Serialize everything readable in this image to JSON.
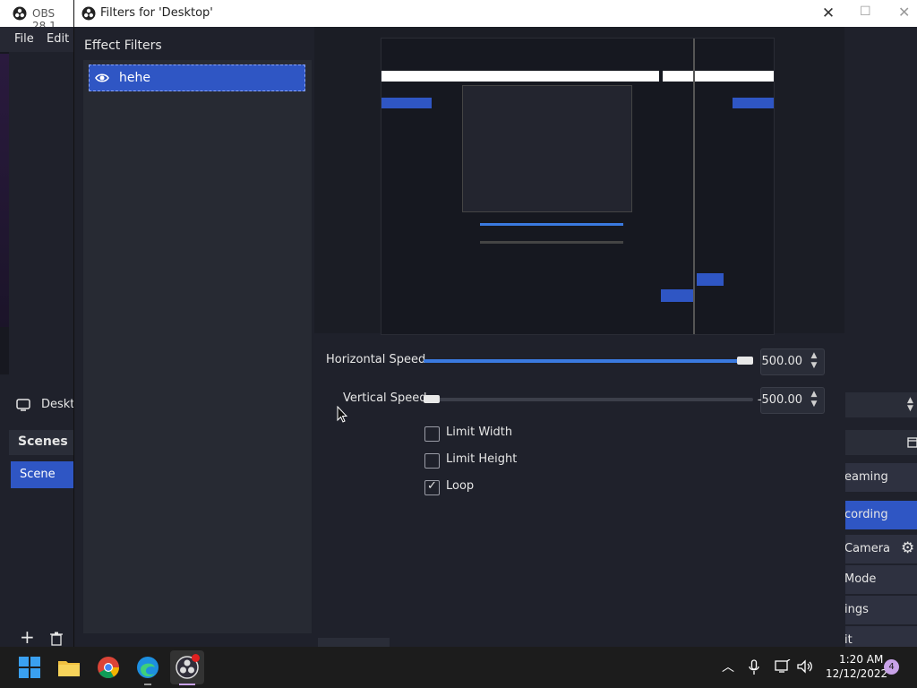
{
  "main_window": {
    "title": "OBS 28.1",
    "menu": {
      "file": "File",
      "edit": "Edit"
    },
    "source_name": "Deskto",
    "scenes_header": "Scenes",
    "scene_item": "Scene",
    "controls": [
      {
        "label": "eaming"
      },
      {
        "label": "cording"
      },
      {
        "label": "Camera"
      },
      {
        "label": "Mode"
      },
      {
        "label": "ings"
      },
      {
        "label": "it"
      }
    ]
  },
  "dialog": {
    "title": "Filters for 'Desktop'",
    "effect_filters_label": "Effect Filters",
    "filters": [
      {
        "name": "hehe"
      }
    ],
    "properties": {
      "horizontal_speed": {
        "label": "Horizontal Speed",
        "value": "500.00",
        "fraction": 1.0
      },
      "vertical_speed": {
        "label": "Vertical Speed",
        "value": "-500.00",
        "fraction": 0.0
      },
      "limit_width": {
        "label": "Limit Width",
        "checked": false
      },
      "limit_height": {
        "label": "Limit Height",
        "checked": false
      },
      "loop": {
        "label": "Loop",
        "checked": true
      }
    }
  },
  "taskbar": {
    "time": "1:20 AM",
    "date": "12/12/2022",
    "notifications": "4"
  },
  "colors": {
    "accent": "#2f56c4",
    "slider_fill": "#3a7ae0",
    "background": "#1f212b"
  }
}
